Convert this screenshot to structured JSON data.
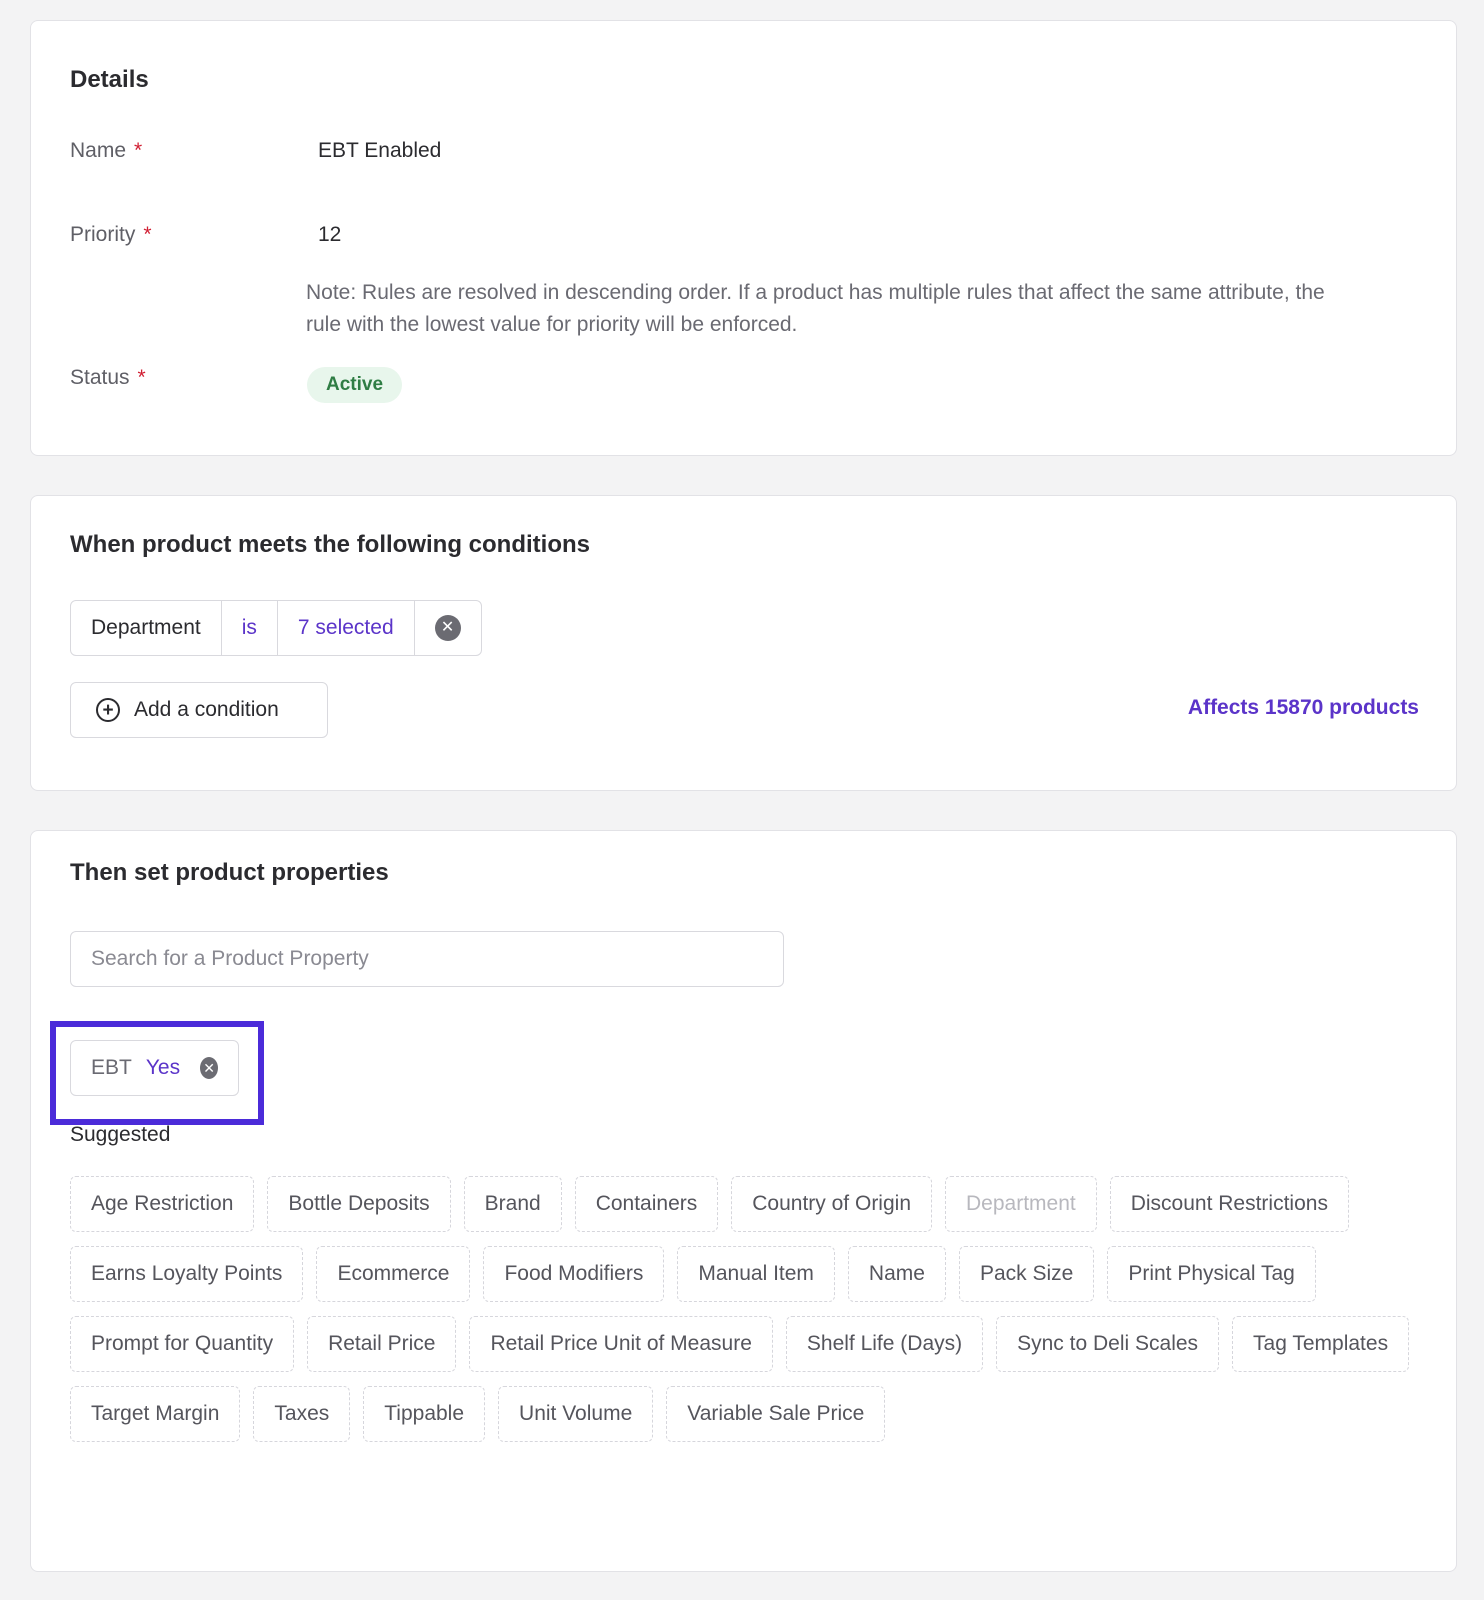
{
  "details": {
    "title": "Details",
    "name_label": "Name",
    "name_value": "EBT Enabled",
    "priority_label": "Priority",
    "priority_value": "12",
    "note": "Note: Rules are resolved in descending order. If a product has multiple rules that affect the same attribute, the rule with the lowest value for priority will be enforced.",
    "status_label": "Status",
    "status_value": "Active",
    "required_mark": "*"
  },
  "conditions": {
    "title": "When product meets the following conditions",
    "condition": {
      "field": "Department",
      "operator": "is",
      "value": "7 selected"
    },
    "add_button_label": "Add a condition",
    "affects_text": "Affects 15870 products"
  },
  "properties": {
    "title": "Then set product properties",
    "search_placeholder": "Search for a Product Property",
    "selected_property": {
      "name": "EBT",
      "value": "Yes"
    },
    "suggested_label": "Suggested",
    "suggested": [
      {
        "label": "Age Restriction",
        "disabled": false
      },
      {
        "label": "Bottle Deposits",
        "disabled": false
      },
      {
        "label": "Brand",
        "disabled": false
      },
      {
        "label": "Containers",
        "disabled": false
      },
      {
        "label": "Country of Origin",
        "disabled": false
      },
      {
        "label": "Department",
        "disabled": true
      },
      {
        "label": "Discount Restrictions",
        "disabled": false
      },
      {
        "label": "Earns Loyalty Points",
        "disabled": false
      },
      {
        "label": "Ecommerce",
        "disabled": false
      },
      {
        "label": "Food Modifiers",
        "disabled": false
      },
      {
        "label": "Manual Item",
        "disabled": false
      },
      {
        "label": "Name",
        "disabled": false
      },
      {
        "label": "Pack Size",
        "disabled": false
      },
      {
        "label": "Print Physical Tag",
        "disabled": false
      },
      {
        "label": "Prompt for Quantity",
        "disabled": false
      },
      {
        "label": "Retail Price",
        "disabled": false
      },
      {
        "label": "Retail Price Unit of Measure",
        "disabled": false
      },
      {
        "label": "Shelf Life (Days)",
        "disabled": false
      },
      {
        "label": "Sync to Deli Scales",
        "disabled": false
      },
      {
        "label": "Tag Templates",
        "disabled": false
      },
      {
        "label": "Target Margin",
        "disabled": false
      },
      {
        "label": "Taxes",
        "disabled": false
      },
      {
        "label": "Tippable",
        "disabled": false
      },
      {
        "label": "Unit Volume",
        "disabled": false
      },
      {
        "label": "Variable Sale Price",
        "disabled": false
      }
    ]
  },
  "colors": {
    "accent": "#5b34c9",
    "highlight": "#4b2bd9",
    "status_bg": "#e8f6ec",
    "status_text": "#2f7d44",
    "required": "#d11f33"
  }
}
